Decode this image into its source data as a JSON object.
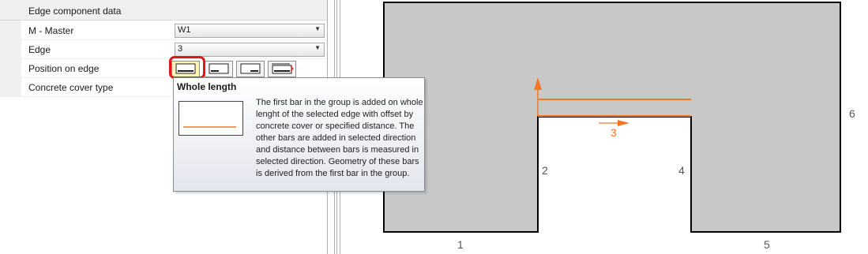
{
  "panel": {
    "section_title": "Edge component data",
    "rows": {
      "master_label": "M - Master",
      "master_value": "W1",
      "edge_label": "Edge",
      "edge_value": "3",
      "position_label": "Position on edge",
      "cover_label": "Concrete cover type"
    },
    "position_buttons": [
      {
        "name": "Whole length",
        "selected": true
      },
      {
        "name": "position-option-2",
        "selected": false
      },
      {
        "name": "position-option-3",
        "selected": false
      },
      {
        "name": "position-option-4",
        "selected": false
      }
    ]
  },
  "tooltip": {
    "title": "Whole length",
    "description": "The first bar in the group is added on whole lenght of the selected edge with offset by concrete cover or specified distance. The other bars are added in selected direction and distance between bars is measured in selected direction. Geometry of these bars is derived from the first bar in the group."
  },
  "drawing": {
    "edge_labels": {
      "e1": "1",
      "e2": "2",
      "e3": "3",
      "e4": "4",
      "e5": "5",
      "e6": "6"
    },
    "colors": {
      "section_fill": "#c8c8c8",
      "outline": "#000000",
      "highlight": "#f07828",
      "selection_ring": "#e11616"
    }
  }
}
